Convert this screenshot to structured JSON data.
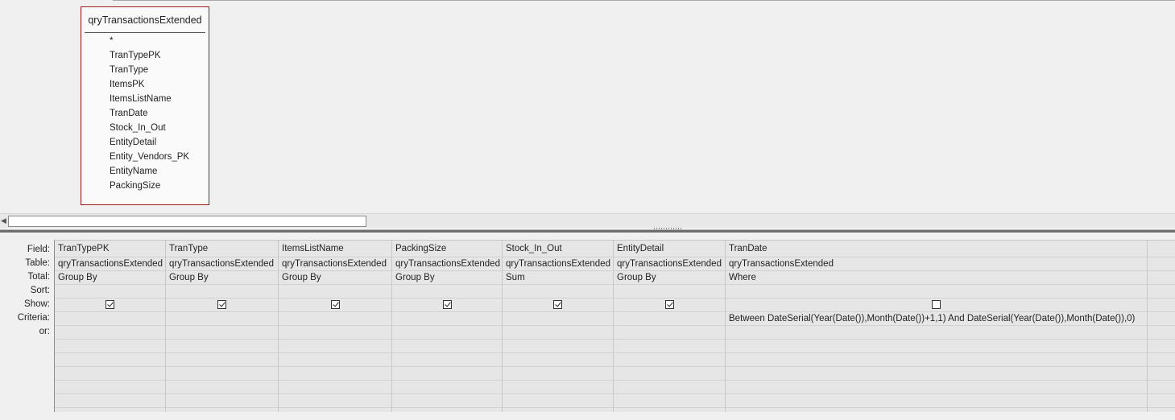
{
  "table": {
    "title": "qryTransactionsExtended",
    "fields": [
      "*",
      "TranTypePK",
      "TranType",
      "ItemsPK",
      "ItemsListName",
      "TranDate",
      "Stock_In_Out",
      "EntityDetail",
      "Entity_Vendors_PK",
      "EntityName",
      "PackingSize"
    ]
  },
  "grid": {
    "row_labels": {
      "field": "Field:",
      "table": "Table:",
      "total": "Total:",
      "sort": "Sort:",
      "show": "Show:",
      "criteria": "Criteria:",
      "or": "or:"
    },
    "columns": [
      {
        "field": "TranTypePK",
        "table": "qryTransactionsExtended",
        "total": "Group By",
        "sort": "",
        "show": true,
        "criteria": "",
        "or": ""
      },
      {
        "field": "TranType",
        "table": "qryTransactionsExtended",
        "total": "Group By",
        "sort": "",
        "show": true,
        "criteria": "",
        "or": ""
      },
      {
        "field": "ItemsListName",
        "table": "qryTransactionsExtended",
        "total": "Group By",
        "sort": "",
        "show": true,
        "criteria": "",
        "or": ""
      },
      {
        "field": "PackingSize",
        "table": "qryTransactionsExtended",
        "total": "Group By",
        "sort": "",
        "show": true,
        "criteria": "",
        "or": ""
      },
      {
        "field": "Stock_In_Out",
        "table": "qryTransactionsExtended",
        "total": "Sum",
        "sort": "",
        "show": true,
        "criteria": "",
        "or": ""
      },
      {
        "field": "EntityDetail",
        "table": "qryTransactionsExtended",
        "total": "Group By",
        "sort": "",
        "show": true,
        "criteria": "",
        "or": ""
      },
      {
        "field": "TranDate",
        "table": "qryTransactionsExtended",
        "total": "Where",
        "sort": "",
        "show": false,
        "criteria": "Between DateSerial(Year(Date()),Month(Date())+1,1) And DateSerial(Year(Date()),Month(Date()),0)",
        "or": ""
      },
      {
        "field": "",
        "table": "",
        "total": "",
        "sort": "",
        "show": null,
        "criteria": "",
        "or": ""
      }
    ]
  }
}
